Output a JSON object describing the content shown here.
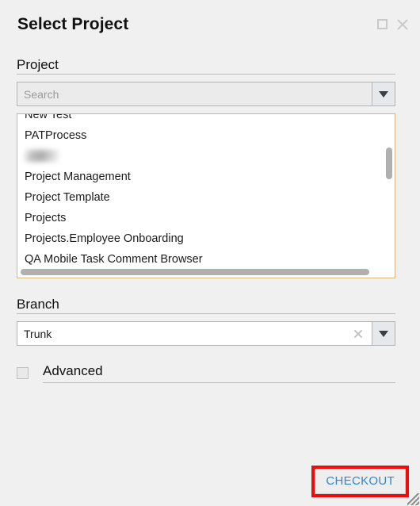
{
  "window": {
    "title": "Select Project",
    "maximize_icon": "square-icon",
    "close_icon": "close-x-icon"
  },
  "project_section": {
    "heading": "Project",
    "search": {
      "placeholder": "Search",
      "value": "",
      "dropdown_icon": "chevron-down-icon"
    },
    "list": {
      "items": [
        {
          "label": "New Test",
          "redacted": false
        },
        {
          "label": "PATProcess",
          "redacted": false
        },
        {
          "label": "",
          "redacted": true
        },
        {
          "label": "Project Management",
          "redacted": false
        },
        {
          "label": "Project Template",
          "redacted": false
        },
        {
          "label": "Projects",
          "redacted": false
        },
        {
          "label": "Projects.Employee Onboarding",
          "redacted": false
        },
        {
          "label": "QA Mobile Task Comment Browser",
          "redacted": false
        }
      ],
      "vertical_scrollbar": "vertical-scrollbar",
      "horizontal_scrollbar": "horizontal-scrollbar",
      "border_color": "#d6b77f"
    }
  },
  "branch_section": {
    "heading": "Branch",
    "input": {
      "value": "Trunk",
      "clear_icon": "clear-x-icon",
      "dropdown_icon": "chevron-down-icon"
    }
  },
  "advanced": {
    "label": "Advanced",
    "checked": false
  },
  "footer": {
    "checkout_label": "CHECKOUT",
    "checkout_text_color": "#2f87d4",
    "highlight_color": "#f30b0b",
    "resize_grip": "resize-grip-icon"
  }
}
